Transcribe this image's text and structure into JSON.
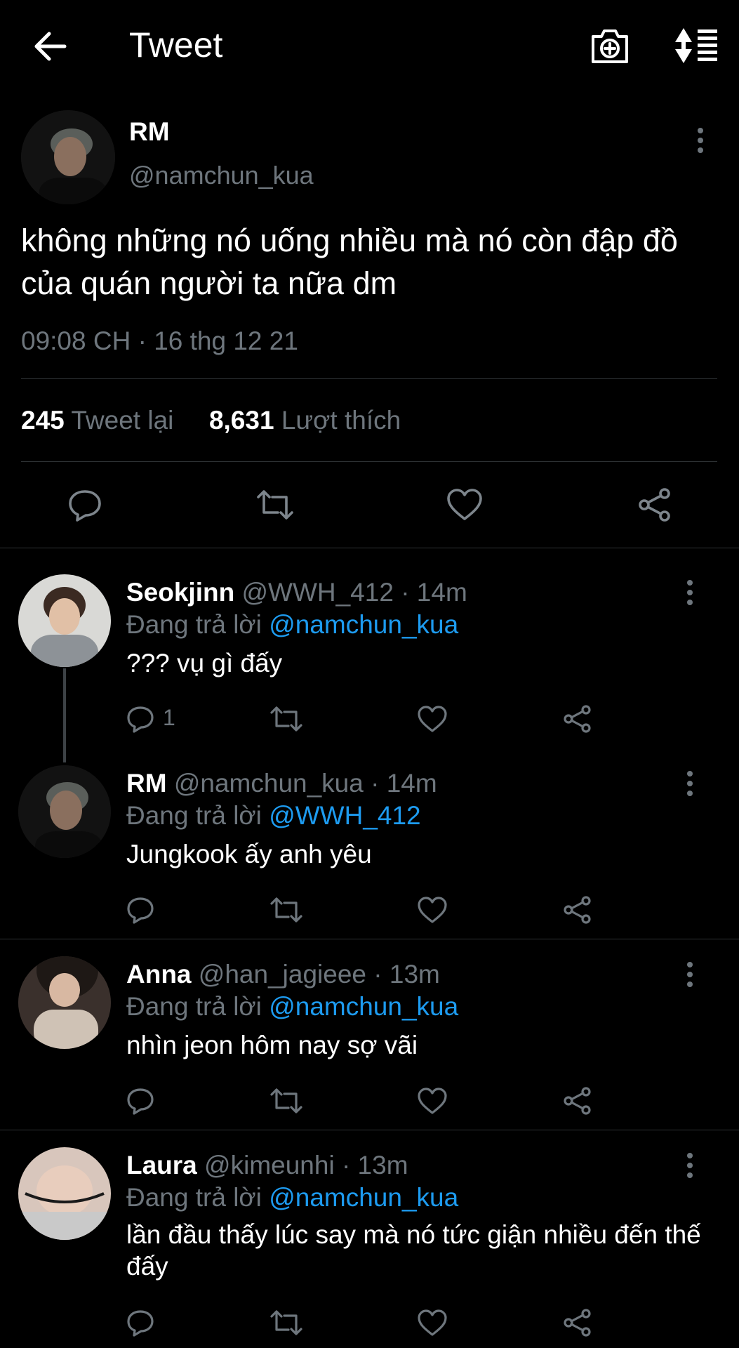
{
  "header": {
    "title": "Tweet",
    "back_icon": "arrow-left-icon",
    "camera_icon": "camera-add-icon",
    "sort_icon": "sort-list-icon"
  },
  "main_tweet": {
    "name": "RM",
    "handle": "@namchun_kua",
    "text": "không những nó uống nhiều mà nó còn đập đồ của quán người ta nữa dm",
    "timestamp": "09:08 CH · 16 thg 12 21",
    "retweets_count": "245",
    "retweets_label": "Tweet lại",
    "likes_count": "8,631",
    "likes_label": "Lượt thích"
  },
  "replies": [
    {
      "name": "Seokjinn",
      "meta": "@WWH_412 · 14m",
      "replying_prefix": "Đang trả lời",
      "replying_to": "@namchun_kua",
      "text": "??? vụ gì đấy",
      "reply_count": "1"
    },
    {
      "name": "RM",
      "meta": "@namchun_kua · 14m",
      "replying_prefix": "Đang trả lời",
      "replying_to": "@WWH_412",
      "text": "Jungkook ấy anh yêu",
      "reply_count": ""
    },
    {
      "name": "Anna",
      "meta": "@han_jagieee · 13m",
      "replying_prefix": "Đang trả lời",
      "replying_to": "@namchun_kua",
      "text": "nhìn jeon hôm nay sợ vãi",
      "reply_count": ""
    },
    {
      "name": "Laura",
      "meta": "@kimeunhi · 13m",
      "replying_prefix": "Đang trả lời",
      "replying_to": "@namchun_kua",
      "text": "lần đầu thấy lúc say mà nó tức giận nhiều đến thế đấy",
      "reply_count": ""
    }
  ],
  "colors": {
    "background": "#000000",
    "secondary_text": "#6e767d",
    "link": "#1d9bf0",
    "divider": "#2f3336"
  }
}
